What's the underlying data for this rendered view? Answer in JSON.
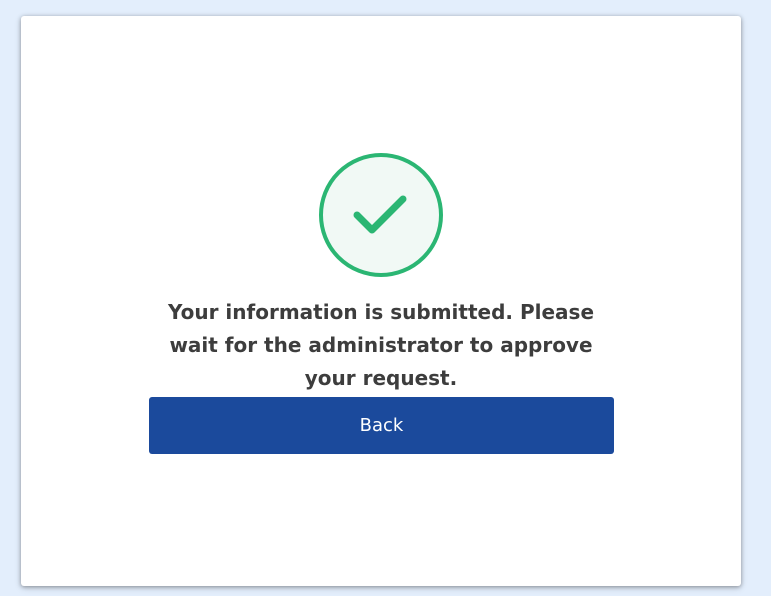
{
  "success": {
    "icon": "checkmark-circle-icon",
    "message": "Your information is submitted. Please wait for the administrator to approve your request.",
    "back_label": "Back"
  },
  "colors": {
    "page_background": "#e3eefc",
    "card_background": "#ffffff",
    "success_green": "#2bb673",
    "success_fill": "#f1f9f5",
    "text": "#3d3d3d",
    "button_background": "#1b4a9c",
    "button_text": "#ffffff"
  }
}
